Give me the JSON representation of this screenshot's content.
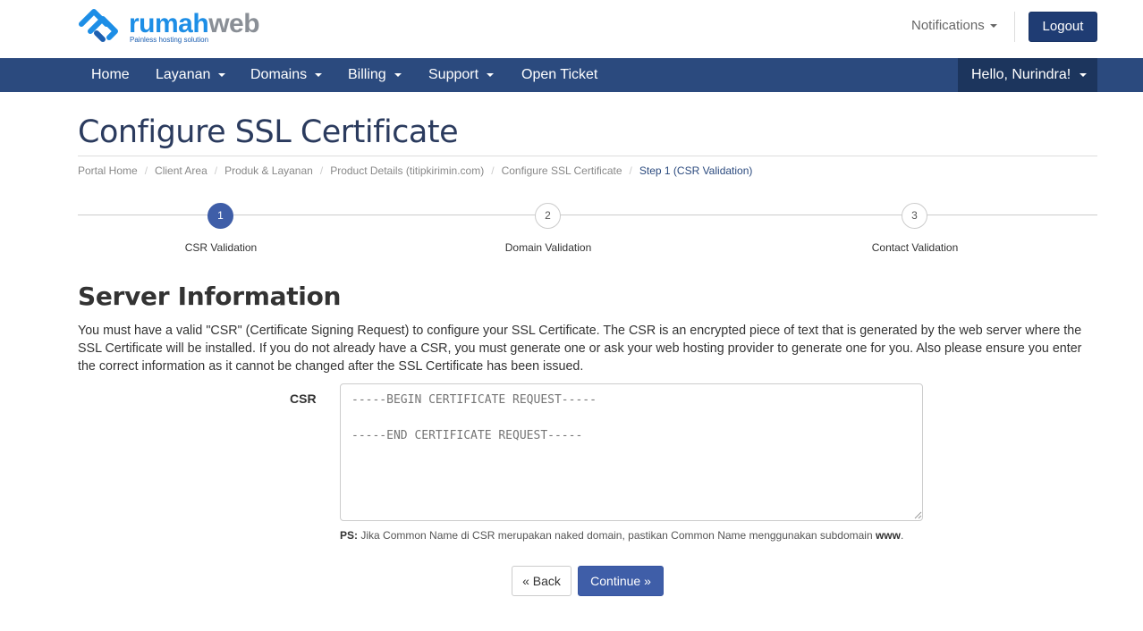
{
  "header": {
    "logo": {
      "word_a": "rumah",
      "word_b": "web",
      "tagline": "Painless hosting solution",
      "icon": "rumahweb-logo-icon"
    },
    "notifications_label": "Notifications",
    "logout_label": "Logout"
  },
  "navbar": {
    "items": [
      {
        "label": "Home"
      },
      {
        "label": "Layanan"
      },
      {
        "label": "Domains"
      },
      {
        "label": "Billing"
      },
      {
        "label": "Support"
      },
      {
        "label": "Open Ticket"
      }
    ],
    "user_label": "Hello, Nurindra!"
  },
  "page": {
    "title": "Configure SSL Certificate",
    "breadcrumb": [
      "Portal Home",
      "Client Area",
      "Produk & Layanan",
      "Product Details (titipkirimin.com)",
      "Configure SSL Certificate",
      "Step 1 (CSR Validation)"
    ]
  },
  "steps": [
    {
      "number": "1",
      "label": "CSR Validation",
      "active": true
    },
    {
      "number": "2",
      "label": "Domain Validation",
      "active": false
    },
    {
      "number": "3",
      "label": "Contact Validation",
      "active": false
    }
  ],
  "section": {
    "title": "Server Information",
    "intro": "You must have a valid \"CSR\" (Certificate Signing Request) to configure your SSL Certificate. The CSR is an encrypted piece of text that is generated by the web server where the SSL Certificate will be installed. If you do not already have a CSR, you must generate one or ask your web hosting provider to generate one for you. Also please ensure you enter the correct information as it cannot be changed after the SSL Certificate has been issued.",
    "csr_label": "CSR",
    "csr_placeholder": "-----BEGIN CERTIFICATE REQUEST-----\n\n-----END CERTIFICATE REQUEST-----",
    "ps_prefix": "PS:",
    "ps_text": " Jika Common Name di CSR merupakan naked domain, pastikan Common Name menggunakan subdomain ",
    "ps_bold": "www",
    "ps_suffix": "."
  },
  "buttons": {
    "back_label": "« Back",
    "continue_label": "Continue »"
  },
  "colors": {
    "brand_blue": "#1d8ee6",
    "navbar": "#2b4a7e",
    "accent": "#3f5ea8",
    "logout": "#1f3c73"
  }
}
